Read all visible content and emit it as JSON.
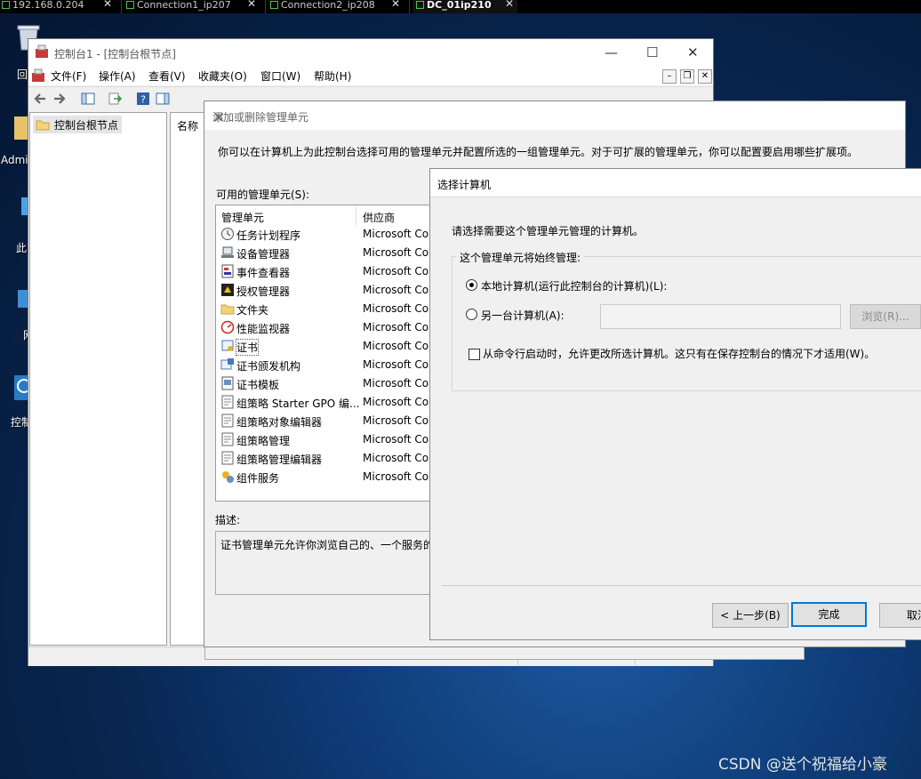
{
  "rdp_tabs": [
    {
      "label": "192.168.0.204"
    },
    {
      "label": "Connection1_ip207"
    },
    {
      "label": "Connection2_ip208"
    },
    {
      "label": "DC_01ip210"
    }
  ],
  "desktop_icons": [
    {
      "label": "回"
    },
    {
      "label": "Admi"
    },
    {
      "label": "此"
    },
    {
      "label": "网"
    },
    {
      "label": "控制"
    }
  ],
  "mmc": {
    "title": "控制台1 - [控制台根节点]",
    "menu": [
      "文件(F)",
      "操作(A)",
      "查看(V)",
      "收藏夹(O)",
      "窗口(W)",
      "帮助(H)"
    ],
    "tree_root": "控制台根节点",
    "name_col": "名称"
  },
  "add_remove_dialog": {
    "title": "添加或删除管理单元",
    "intro": "你可以在计算机上为此控制台选择可用的管理单元并配置所选的一组管理单元。对于可扩展的管理单元，你可以配置要启用哪些扩展项。",
    "available_label": "可用的管理单元(S):",
    "col_snapin": "管理单元",
    "col_vendor": "供应商",
    "snapins": [
      {
        "name": "任务计划程序",
        "vendor": "Microsoft Co",
        "icon": "clock-icon"
      },
      {
        "name": "设备管理器",
        "vendor": "Microsoft Co",
        "icon": "device-manager-icon"
      },
      {
        "name": "事件查看器",
        "vendor": "Microsoft Co",
        "icon": "event-viewer-icon"
      },
      {
        "name": "授权管理器",
        "vendor": "Microsoft Co",
        "icon": "authorization-icon"
      },
      {
        "name": "文件夹",
        "vendor": "Microsoft Co",
        "icon": "folder-icon"
      },
      {
        "name": "性能监视器",
        "vendor": "Microsoft Co",
        "icon": "performance-icon"
      },
      {
        "name": "证书",
        "vendor": "Microsoft Co",
        "icon": "certificate-icon"
      },
      {
        "name": "证书颁发机构",
        "vendor": "Microsoft Co",
        "icon": "certificate-authority-icon"
      },
      {
        "name": "证书模板",
        "vendor": "Microsoft Co",
        "icon": "certificate-template-icon"
      },
      {
        "name": "组策略 Starter GPO 编...",
        "vendor": "Microsoft Co",
        "icon": "gpo-icon"
      },
      {
        "name": "组策略对象编辑器",
        "vendor": "Microsoft Co",
        "icon": "gpo-icon"
      },
      {
        "name": "组策略管理",
        "vendor": "Microsoft Co",
        "icon": "gpo-icon"
      },
      {
        "name": "组策略管理编辑器",
        "vendor": "Microsoft Co",
        "icon": "gpo-icon"
      },
      {
        "name": "组件服务",
        "vendor": "Microsoft Co",
        "icon": "component-services-icon"
      }
    ],
    "selected_index": 6,
    "description_label": "描述:",
    "description": "证书管理单元允许你浏览自己的、一个服务的"
  },
  "select_computer_dialog": {
    "title": "选择计算机",
    "prompt": "请选择需要这个管理单元管理的计算机。",
    "group_label": "这个管理单元将始终管理:",
    "option_local": "本地计算机(运行此控制台的计算机)(L):",
    "option_remote": "另一台计算机(A):",
    "remote_value": "",
    "browse_label": "浏览(R)...",
    "checkbox_label": "从命令行启动时，允许更改所选计算机。这只有在保存控制台的情况下才适用(W)。",
    "local_selected": true,
    "checkbox_checked": false,
    "back_label": "< 上一步(B)",
    "finish_label": "完成",
    "cancel_label": "取消"
  },
  "watermark": "CSDN @送个祝福给小豪",
  "colors": {
    "accent": "#0078d7",
    "desktop": "#0e3b77"
  }
}
